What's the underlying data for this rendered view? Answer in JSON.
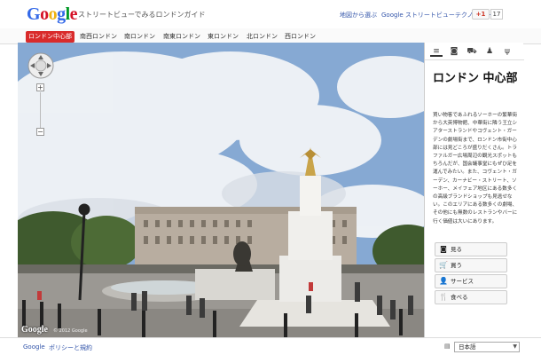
{
  "header": {
    "logo_letters": [
      {
        "ch": "G",
        "color": "#3369e8"
      },
      {
        "ch": "o",
        "color": "#d50f25"
      },
      {
        "ch": "o",
        "color": "#eeb211"
      },
      {
        "ch": "g",
        "color": "#3369e8"
      },
      {
        "ch": "l",
        "color": "#009925"
      },
      {
        "ch": "e",
        "color": "#d50f25"
      }
    ],
    "site_title": "ストリートビューでみるロンドンガイド",
    "link_map": "地図から選ぶ",
    "link_tech": "Google ストリートビューテクノロジー",
    "gplus_label": "+1",
    "gplus_count": "17"
  },
  "nav": {
    "items": [
      {
        "label": "ロンドン中心部",
        "active": true
      },
      {
        "label": "南西ロンドン",
        "active": false
      },
      {
        "label": "南ロンドン",
        "active": false
      },
      {
        "label": "南東ロンドン",
        "active": false
      },
      {
        "label": "東ロンドン",
        "active": false
      },
      {
        "label": "北ロンドン",
        "active": false
      },
      {
        "label": "西ロンドン",
        "active": false
      }
    ]
  },
  "view": {
    "zoom_plus": "+",
    "zoom_minus": "−",
    "watermark": "Google",
    "copyright": "© 2012 Google"
  },
  "panel": {
    "tab_icons": [
      "list-icon",
      "camera-icon",
      "cart-icon",
      "person-icon",
      "fork-knife-icon"
    ],
    "title": "ロンドン 中心部",
    "description": "買い物客であふれるソーホーの繁華街から大英博物館、中華街に隣う王立シアターストランドやコヴェント・ガーデンの劇場街まで、ロンドン市街中心部には見どころが盛りだくさん。トラファルガー広場周辺の観光スポットもちろんだが、国会議事堂にもぜひ足を運んでみたい。また、コヴェント・ガーデン、カーナビー・ストリート、ソーホー、メイフェア地区にある数多くの高級ブランドショップも見逃せない。このエリアにある数多くの劇場、その他にも無数のレストランやバーに行く価値は大いにあります。",
    "buttons": [
      {
        "label": "見る",
        "icon": "camera-icon",
        "glyph": "◙"
      },
      {
        "label": "買う",
        "icon": "cart-icon",
        "glyph": "🛒"
      },
      {
        "label": "サービス",
        "icon": "person-icon",
        "glyph": "👤"
      },
      {
        "label": "食べる",
        "icon": "fork-knife-icon",
        "glyph": "🍴"
      }
    ]
  },
  "footer": {
    "link_google": "Google",
    "link_policy": "ポリシーと規約",
    "language": "日本語"
  },
  "colors": {
    "nav_active": "#d92b2b",
    "link": "#3355aa",
    "sky": "#7fa3cf"
  }
}
